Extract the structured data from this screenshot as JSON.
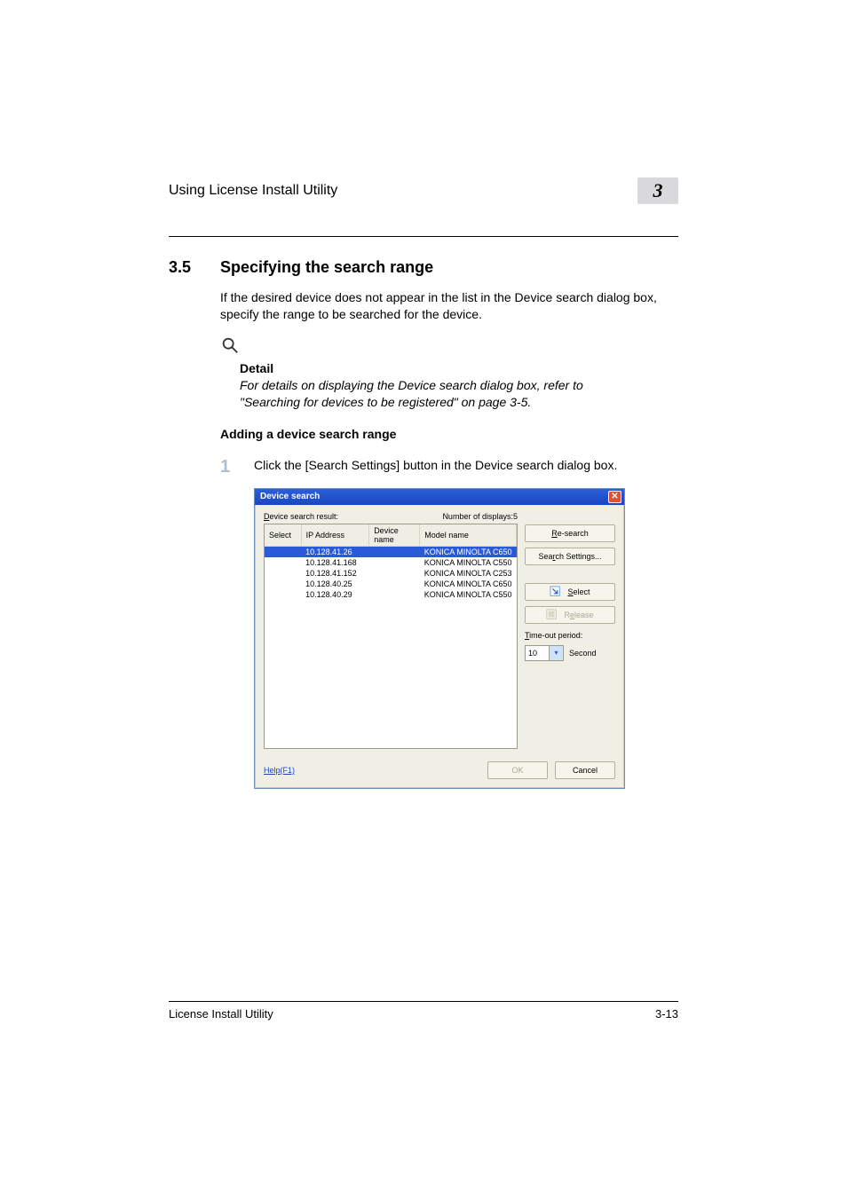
{
  "header": {
    "running_head": "Using License Install Utility",
    "chapter_number": "3"
  },
  "section": {
    "number": "3.5",
    "title": "Specifying the search range",
    "intro": "If the desired device does not appear in the list in the Device search dialog box, specify the range to be searched for the device."
  },
  "detail": {
    "label": "Detail",
    "text": "For details on displaying the Device search dialog box, refer to \"Searching for devices to be registered\" on page 3-5."
  },
  "subheading": "Adding a device search range",
  "step": {
    "number": "1",
    "text": "Click the [Search Settings] button in the Device search dialog box."
  },
  "dialog": {
    "title": "Device search",
    "result_label_pre": "D",
    "result_label_rest": "evice search result:",
    "displays_label": "Number of displays:",
    "displays_value": "5",
    "columns": {
      "select": "Select",
      "ip": "IP Address",
      "device": "Device name",
      "model": "Model name"
    },
    "rows": [
      {
        "ip": "10.128.41.26",
        "device": "",
        "model": "KONICA MINOLTA C650",
        "selected": true
      },
      {
        "ip": "10.128.41.168",
        "device": "",
        "model": "KONICA MINOLTA C550",
        "selected": false
      },
      {
        "ip": "10.128.41.152",
        "device": "",
        "model": "KONICA MINOLTA C253",
        "selected": false
      },
      {
        "ip": "10.128.40.25",
        "device": "",
        "model": "KONICA MINOLTA C650",
        "selected": false
      },
      {
        "ip": "10.128.40.29",
        "device": "",
        "model": "KONICA MINOLTA C550",
        "selected": false
      }
    ],
    "buttons": {
      "research_u": "R",
      "research_rest": "e-search",
      "search_settings_pre": "Sea",
      "search_settings_u": "r",
      "search_settings_rest": "ch Settings...",
      "select_u": "S",
      "select_rest": "elect",
      "release_pre": "R",
      "release_u": "e",
      "release_rest": "lease"
    },
    "timeout": {
      "label_u": "T",
      "label_rest": "ime-out period:",
      "value": "10",
      "unit": "Second"
    },
    "footer": {
      "help_u": "H",
      "help_rest": "elp(F1)",
      "ok": "OK",
      "cancel": "Cancel"
    }
  },
  "footer": {
    "product": "License Install Utility",
    "page": "3-13"
  }
}
